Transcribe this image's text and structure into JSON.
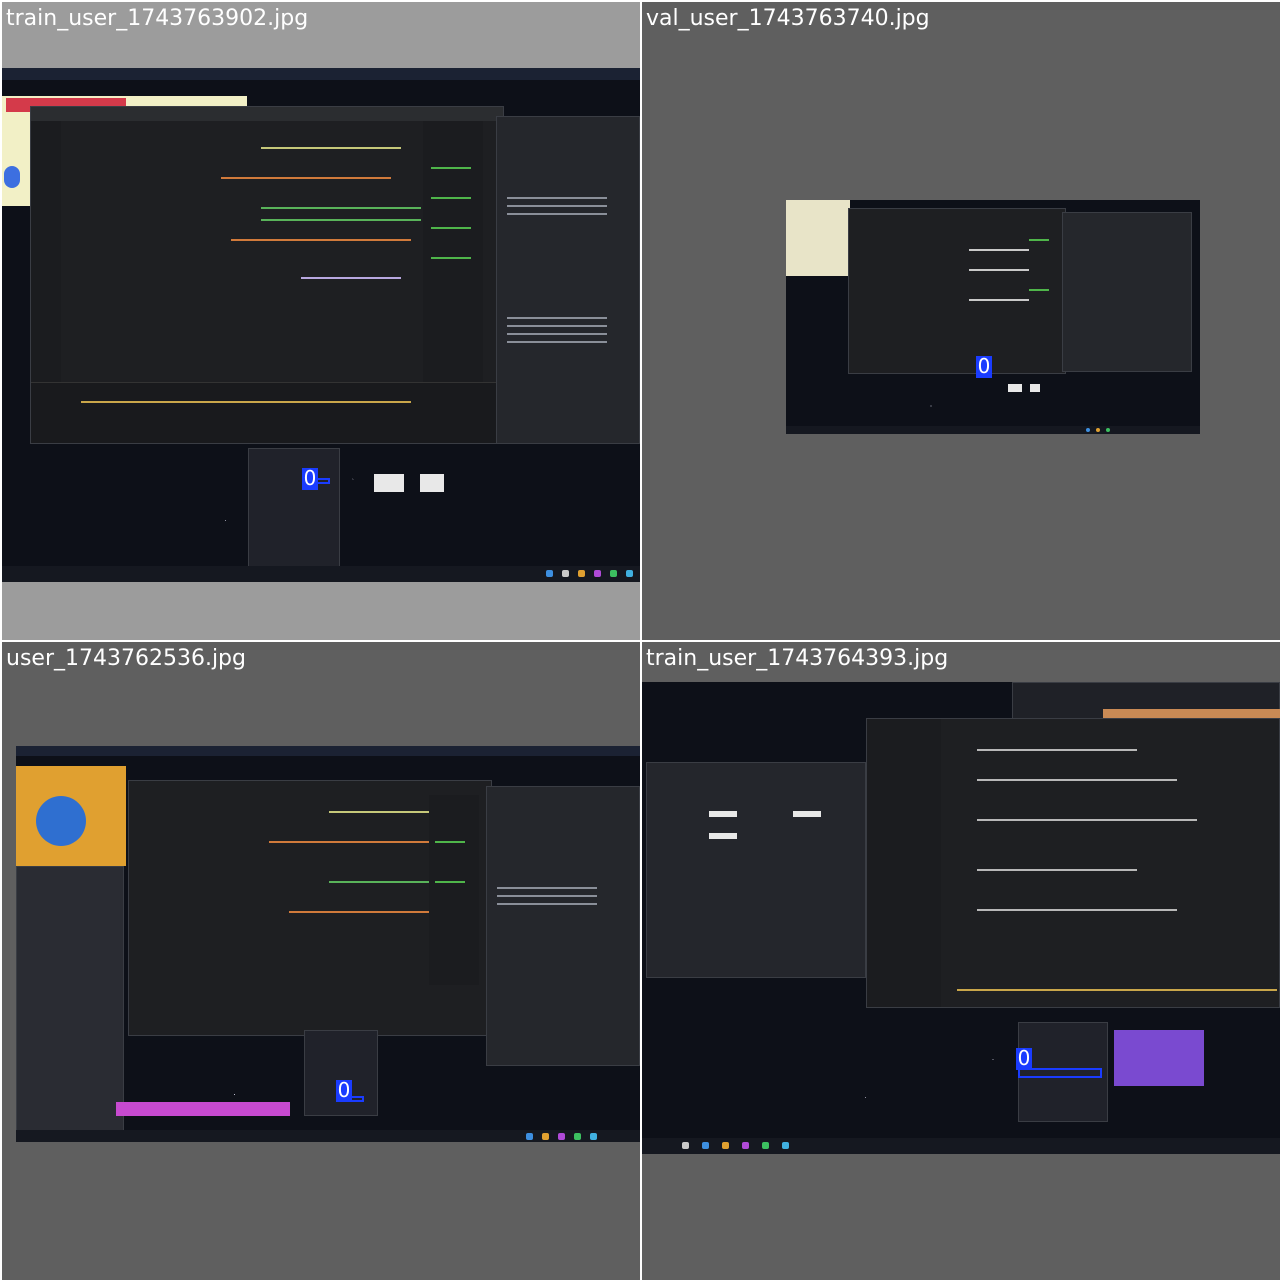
{
  "tiles": [
    {
      "filename": "train_user_1743763902.jpg",
      "label": "0"
    },
    {
      "filename": "val_user_1743763740.jpg",
      "label": "0"
    },
    {
      "filename": "user_1743762536.jpg",
      "label": "0"
    },
    {
      "filename": "train_user_1743764393.jpg",
      "label": "0"
    }
  ],
  "colors": {
    "tile_bg_light": "#9c9c9c",
    "tile_bg_dark": "#5f5f5f",
    "box": "#1a3cff",
    "editor_bg": "#1e1f22",
    "desktop_bg": "#0d1018"
  }
}
